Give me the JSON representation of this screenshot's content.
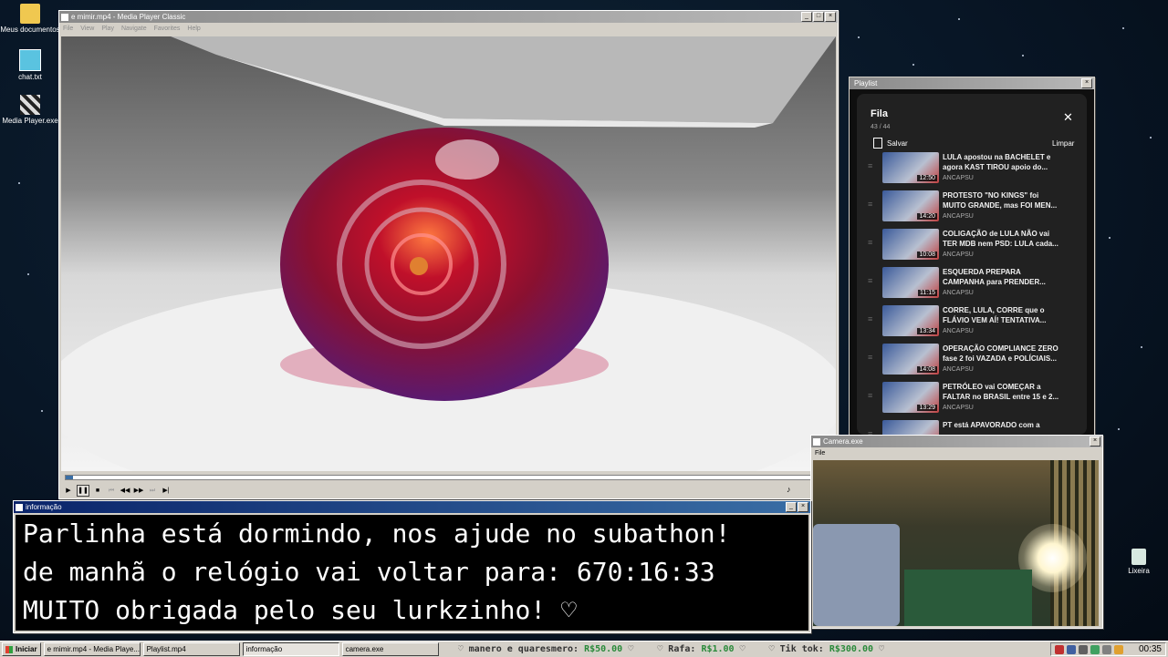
{
  "desktop_icons": [
    {
      "label": "Meus documentos",
      "icon": "folder-icon"
    },
    {
      "label": "chat.txt",
      "icon": "notepad-icon"
    },
    {
      "label": "Media Player.exe",
      "icon": "clapper-icon"
    }
  ],
  "recycle_bin": {
    "label": "Lixeira",
    "icon": "recycle-bin-icon"
  },
  "media_player": {
    "title": "e mimir.mp4 - Media Player Classic",
    "menu": [
      "File",
      "View",
      "Play",
      "Navigate",
      "Favorites",
      "Help"
    ],
    "seek_position": 0.01
  },
  "info_window": {
    "title": "informação",
    "lines": [
      "Parlinha está dormindo, nos ajude no subathon!",
      "de manhã o relógio vai voltar para:  670:16:33",
      "MUITO obrigada pelo seu lurkzinho! ♡"
    ]
  },
  "playlist": {
    "window_title": "Playlist",
    "header": "Fila",
    "count": "43 / 44",
    "save_label": "Salvar",
    "clear_label": "Limpar",
    "items": [
      {
        "title": "LULA apostou na BACHELET e agora KAST TIROU apoio do...",
        "duration": "12:50",
        "channel": "ANCAPSU"
      },
      {
        "title": "PROTESTO \"NO KINGS\" foi MUITO GRANDE, mas FOI MEN...",
        "duration": "14:20",
        "channel": "ANCAPSU"
      },
      {
        "title": "COLIGAÇÃO de LULA NÃO vai TER MDB nem PSD: LULA cada...",
        "duration": "10:08",
        "channel": "ANCAPSU"
      },
      {
        "title": "ESQUERDA PREPARA CAMPANHA para PRENDER...",
        "duration": "11:15",
        "channel": "ANCAPSU"
      },
      {
        "title": "CORRE, LULA, CORRE que o FLÁVIO VEM AÍ! TENTATIVA...",
        "duration": "13:34",
        "channel": "ANCAPSU"
      },
      {
        "title": "OPERAÇÃO COMPLIANCE ZERO fase 2 foi VAZADA e POLÍCIAIS...",
        "duration": "14:08",
        "channel": "ANCAPSU"
      },
      {
        "title": "PETRÓLEO vai COMEÇAR a FALTAR no BRASIL entre 15 e 2...",
        "duration": "13:29",
        "channel": "ANCAPSU"
      },
      {
        "title": "PT está APAVORADO com a",
        "duration": "",
        "channel": ""
      }
    ]
  },
  "camera": {
    "title": "Camera.exe",
    "menu": [
      "File"
    ]
  },
  "taskbar": {
    "start_label": "Iniciar",
    "tasks": [
      {
        "label": "e mimir.mp4 - Media Playe..."
      },
      {
        "label": "Playlist.mp4"
      },
      {
        "label": "informação"
      },
      {
        "label": "camera.exe"
      }
    ],
    "ticker": [
      {
        "prefix": "♡ manero e quaresmero: ",
        "amount": "R$50.00",
        "suffix": " ♡"
      },
      {
        "prefix": "♡ Rafa: ",
        "amount": "R$1.00",
        "suffix": " ♡"
      },
      {
        "prefix": "♡ Tik tok: ",
        "amount": "R$300.00",
        "suffix": " ♡"
      }
    ],
    "clock": "00:35"
  }
}
